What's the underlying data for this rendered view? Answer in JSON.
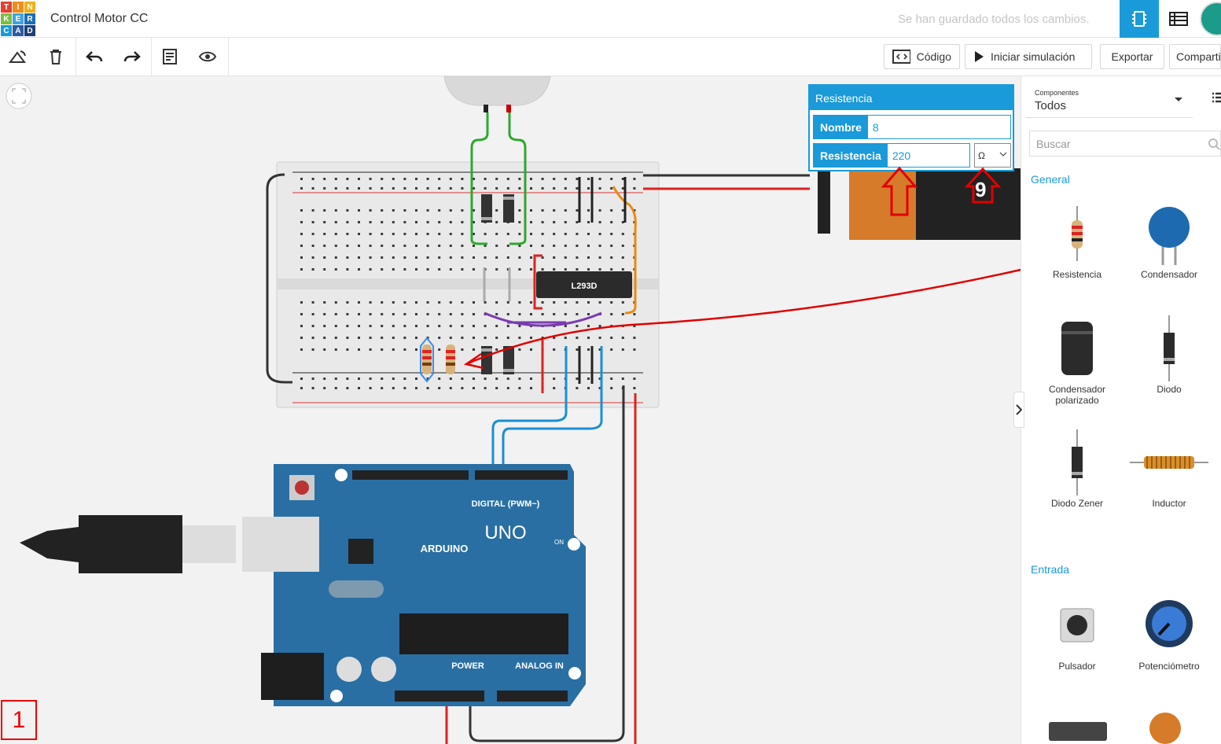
{
  "app": {
    "logo_letters": [
      "T",
      "I",
      "N",
      "K",
      "E",
      "R",
      "C",
      "A",
      "D"
    ],
    "title": "Control Motor CC",
    "save_status": "Se han guardado todos los cambios."
  },
  "toolbar": {
    "code_label": "Código",
    "simulate_label": "Iniciar simulación",
    "export_label": "Exportar",
    "share_label": "Compartir"
  },
  "inspector": {
    "header": "Resistencia",
    "name_label": "Nombre",
    "name_value": "8",
    "value_label": "Resistencia",
    "value_value": "220",
    "unit": "Ω"
  },
  "sidebar": {
    "components_caption": "Componentes",
    "components_value": "Todos",
    "search_placeholder": "Buscar",
    "general_title": "General",
    "general_items": [
      "Resistencia",
      "Condensador",
      "Condensador polarizado",
      "Diodo",
      "Diodo Zener",
      "Inductor"
    ],
    "input_title": "Entrada",
    "input_items": [
      "Pulsador",
      "Potenciómetro"
    ]
  },
  "circuit": {
    "ic_label": "L293D",
    "arduino_brand": "ARDUINO",
    "arduino_model": "UNO",
    "digital_label": "DIGITAL (PWM~)",
    "power_label": "POWER",
    "analog_label": "ANALOG IN",
    "on_label": "ON",
    "battery_label": "9"
  },
  "annotation": {
    "number": "1"
  },
  "colors": {
    "accent": "#1a9ad9",
    "annotation": "#e00000",
    "arduino_board": "#2a6fa3"
  }
}
